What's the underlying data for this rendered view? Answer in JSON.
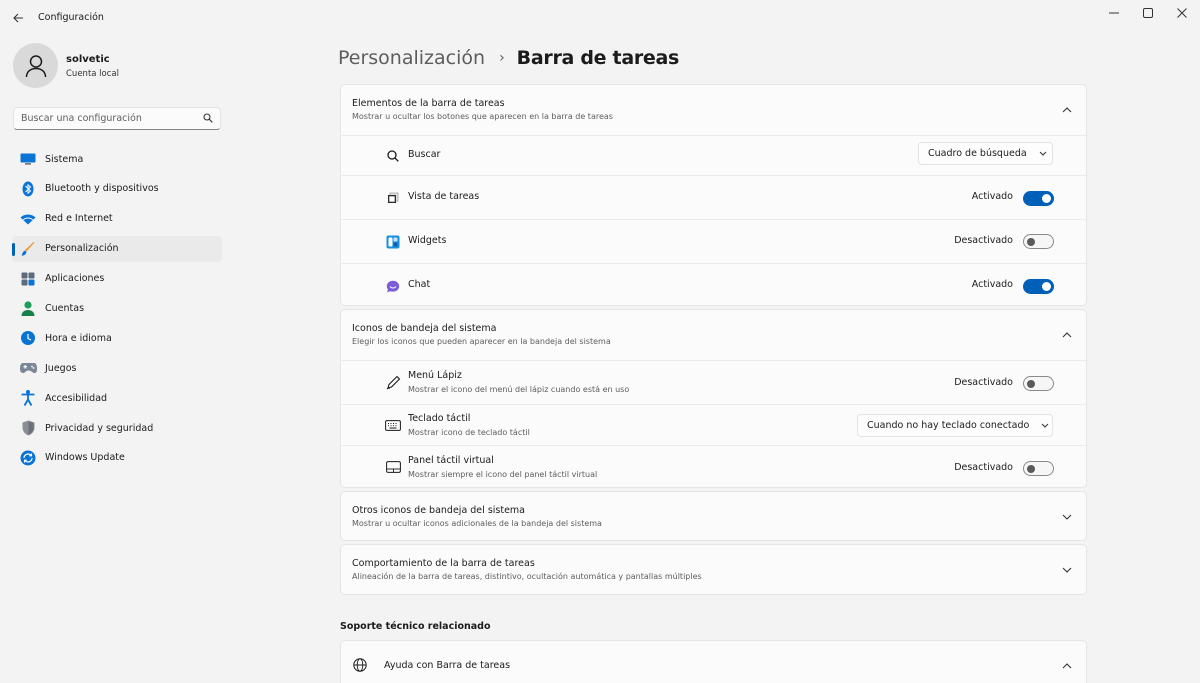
{
  "window": {
    "title": "Configuración"
  },
  "profile": {
    "name": "solvetic",
    "account_type": "Cuenta local"
  },
  "search": {
    "placeholder": "Buscar una configuración"
  },
  "sidebar": {
    "items": [
      {
        "label": "Sistema",
        "icon": "monitor-icon"
      },
      {
        "label": "Bluetooth y dispositivos",
        "icon": "bluetooth-icon"
      },
      {
        "label": "Red e Internet",
        "icon": "wifi-icon"
      },
      {
        "label": "Personalización",
        "icon": "brush-icon",
        "active": true
      },
      {
        "label": "Aplicaciones",
        "icon": "apps-icon"
      },
      {
        "label": "Cuentas",
        "icon": "person-icon"
      },
      {
        "label": "Hora e idioma",
        "icon": "clock-globe-icon"
      },
      {
        "label": "Juegos",
        "icon": "gamepad-icon"
      },
      {
        "label": "Accesibilidad",
        "icon": "accessibility-icon"
      },
      {
        "label": "Privacidad y seguridad",
        "icon": "shield-icon"
      },
      {
        "label": "Windows Update",
        "icon": "update-icon"
      }
    ]
  },
  "breadcrumb": {
    "parent": "Personalización",
    "separator": "›",
    "current": "Barra de tareas"
  },
  "taskbar_items": {
    "title": "Elementos de la barra de tareas",
    "subtitle": "Mostrar u ocultar los botones que aparecen en la barra de tareas",
    "rows": [
      {
        "label": "Buscar",
        "control": "dropdown",
        "value": "Cuadro de búsqueda",
        "icon": "search-icon"
      },
      {
        "label": "Vista de tareas",
        "control": "toggle",
        "state": "Activado",
        "on": true,
        "icon": "task-view-icon"
      },
      {
        "label": "Widgets",
        "control": "toggle",
        "state": "Desactivado",
        "on": false,
        "icon": "widgets-icon"
      },
      {
        "label": "Chat",
        "control": "toggle",
        "state": "Activado",
        "on": true,
        "icon": "chat-icon"
      }
    ]
  },
  "tray_icons": {
    "title": "Iconos de bandeja del sistema",
    "subtitle": "Elegir los iconos que pueden aparecer en la bandeja del sistema",
    "rows": [
      {
        "label": "Menú Lápiz",
        "sub": "Mostrar el icono del menú del lápiz cuando está en uso",
        "control": "toggle",
        "state": "Desactivado",
        "on": false,
        "icon": "pen-icon"
      },
      {
        "label": "Teclado táctil",
        "sub": "Mostrar icono de teclado táctil",
        "control": "dropdown",
        "value": "Cuando no hay teclado conectado",
        "icon": "keyboard-icon"
      },
      {
        "label": "Panel táctil virtual",
        "sub": "Mostrar siempre el icono del panel táctil virtual",
        "control": "toggle",
        "state": "Desactivado",
        "on": false,
        "icon": "touchpad-icon"
      }
    ]
  },
  "other_tray": {
    "title": "Otros iconos de bandeja del sistema",
    "subtitle": "Mostrar u ocultar iconos adicionales de la bandeja del sistema"
  },
  "behavior": {
    "title": "Comportamiento de la barra de tareas",
    "subtitle": "Alineación de la barra de tareas, distintivo, ocultación automática y pantallas múltiples"
  },
  "related": {
    "title": "Soporte técnico relacionado",
    "help_label": "Ayuda con Barra de tareas"
  },
  "colors": {
    "accent": "#005fb8",
    "background": "#f3f3f3",
    "card": "#fbfbfb"
  }
}
